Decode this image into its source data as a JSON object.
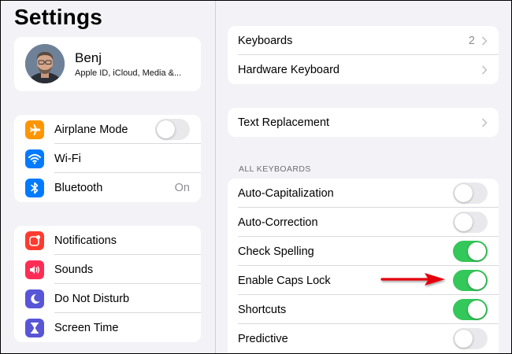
{
  "sidebar": {
    "title": "Settings",
    "profile": {
      "name": "Benj",
      "subtitle": "Apple ID, iCloud, Media &..."
    },
    "group1": [
      {
        "label": "Airplane Mode",
        "icon": "airplane-icon",
        "color": "#ff9500",
        "toggle": false
      },
      {
        "label": "Wi-Fi",
        "icon": "wifi-icon",
        "color": "#007aff"
      },
      {
        "label": "Bluetooth",
        "icon": "bluetooth-icon",
        "color": "#007aff",
        "value": "On"
      }
    ],
    "group2": [
      {
        "label": "Notifications",
        "icon": "notifications-icon",
        "color": "#ff3b30"
      },
      {
        "label": "Sounds",
        "icon": "speaker-icon",
        "color": "#ff2d55"
      },
      {
        "label": "Do Not Disturb",
        "icon": "moon-icon",
        "color": "#5856d6"
      },
      {
        "label": "Screen Time",
        "icon": "hourglass-icon",
        "color": "#5856d6"
      }
    ]
  },
  "detail": {
    "group1": [
      {
        "label": "Keyboards",
        "value": "2"
      },
      {
        "label": "Hardware Keyboard"
      }
    ],
    "group2": [
      {
        "label": "Text Replacement"
      }
    ],
    "section_header": "ALL KEYBOARDS",
    "toggles": [
      {
        "label": "Auto-Capitalization",
        "on": false
      },
      {
        "label": "Auto-Correction",
        "on": false
      },
      {
        "label": "Check Spelling",
        "on": true
      },
      {
        "label": "Enable Caps Lock",
        "on": true
      },
      {
        "label": "Shortcuts",
        "on": true
      },
      {
        "label": "Predictive",
        "on": false
      }
    ]
  },
  "colors": {
    "toggle_on": "#34c759",
    "toggle_off": "#e9e9eb",
    "annotation_arrow": "#e3000f"
  }
}
